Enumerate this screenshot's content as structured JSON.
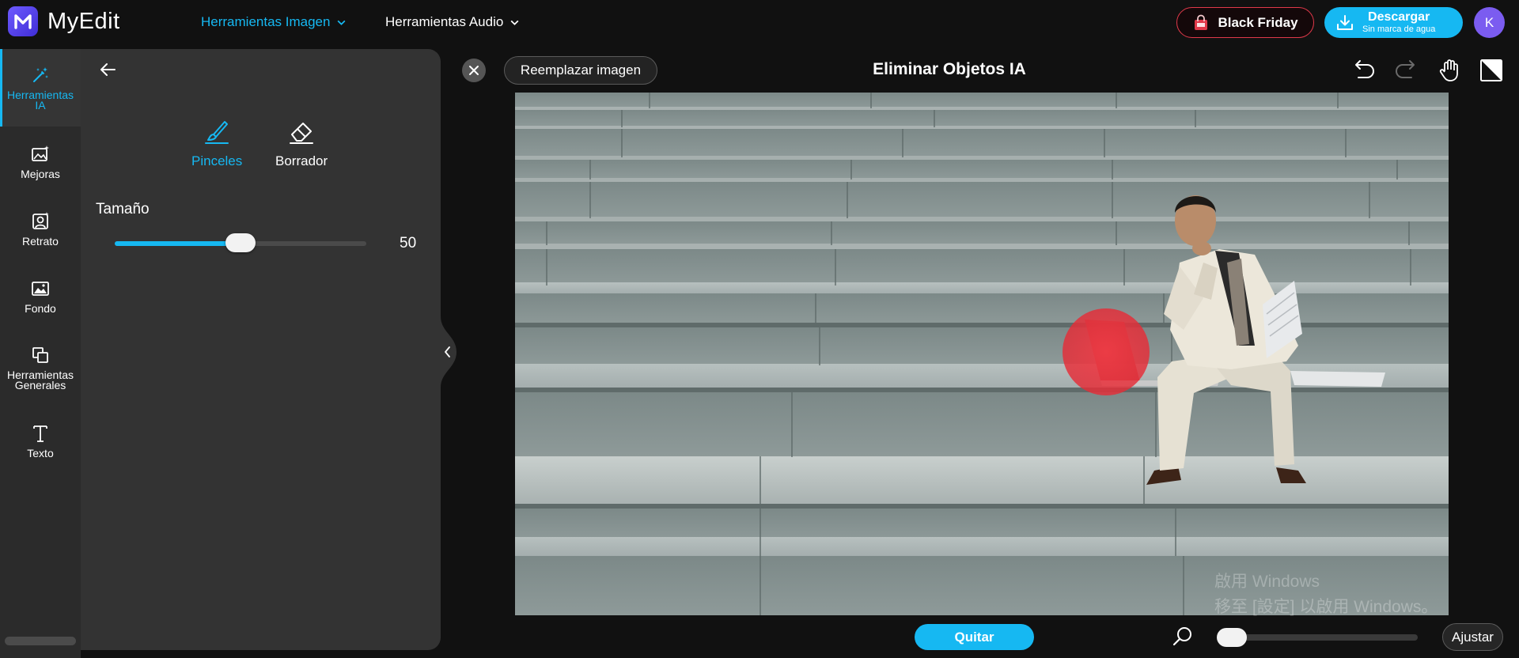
{
  "app": {
    "name": "MyEdit",
    "logo_letter": "M"
  },
  "nav": {
    "image_tools": "Herramientas Imagen",
    "audio_tools": "Herramientas Audio"
  },
  "header_actions": {
    "black_friday": "Black Friday",
    "download_main": "Descargar",
    "download_sub": "Sin marca de agua",
    "avatar_initial": "K"
  },
  "rail": {
    "items": [
      {
        "label_line1": "Herramientas",
        "label_line2": "IA",
        "icon": "magic-wand-icon",
        "active": true
      },
      {
        "label_line1": "Mejoras",
        "label_line2": "",
        "icon": "image-sparkle-icon",
        "active": false
      },
      {
        "label_line1": "Retrato",
        "label_line2": "",
        "icon": "portrait-icon",
        "active": false
      },
      {
        "label_line1": "Fondo",
        "label_line2": "",
        "icon": "background-icon",
        "active": false
      },
      {
        "label_line1": "Herramientas",
        "label_line2": "Generales",
        "icon": "copy-icon",
        "active": false
      },
      {
        "label_line1": "Texto",
        "label_line2": "",
        "icon": "text-icon",
        "active": false
      }
    ]
  },
  "panel": {
    "brush_label": "Pinceles",
    "eraser_label": "Borrador",
    "size_label": "Tamaño",
    "size_value": "50",
    "size_fraction": 0.5
  },
  "canvas": {
    "replace_label": "Reemplazar imagen",
    "title": "Eliminar Objetos IA"
  },
  "bottom": {
    "remove_label": "Quitar",
    "fit_label": "Ajustar",
    "zoom_fraction": 0.0
  },
  "watermark": {
    "line1": "啟用 Windows",
    "line2": "移至 [設定] 以啟用 Windows。"
  },
  "colors": {
    "accent": "#16b8f2",
    "brand": "#5b47f0",
    "black_friday_border": "#e0394a",
    "brush_mark": "#e8303c"
  }
}
